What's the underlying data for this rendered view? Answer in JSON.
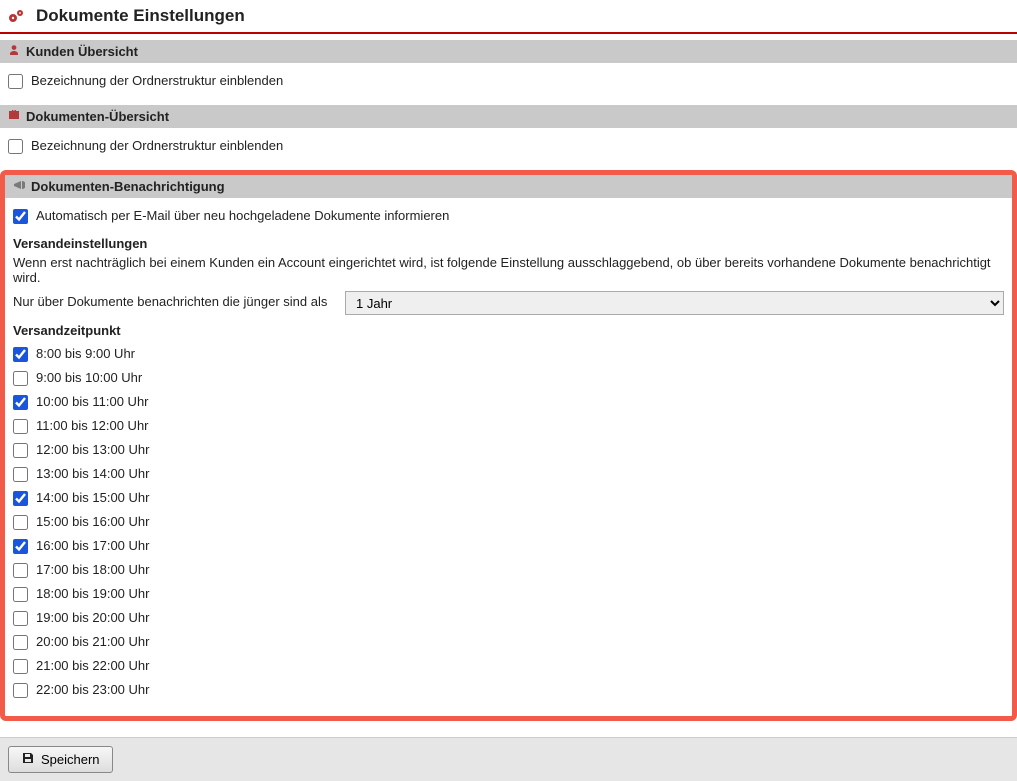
{
  "page": {
    "title": "Dokumente Einstellungen"
  },
  "sections": {
    "customers": {
      "title": "Kunden Übersicht",
      "cb_label": "Bezeichnung der Ordnerstruktur einblenden",
      "cb_checked": false
    },
    "documents": {
      "title": "Dokumenten-Übersicht",
      "cb_label": "Bezeichnung der Ordnerstruktur einblenden",
      "cb_checked": false
    },
    "notify": {
      "title": "Dokumenten-Benachrichtigung",
      "auto_label": "Automatisch per E-Mail über neu hochgeladene Dokumente informieren",
      "auto_checked": true,
      "dispatch_heading": "Versandeinstellungen",
      "dispatch_desc": "Wenn erst nachträglich bei einem Kunden ein Account eingerichtet wird, ist folgende Einstellung ausschlaggebend, ob über bereits vorhandene Dokumente benachrichtigt wird.",
      "age_label": "Nur über Dokumente benachrichten die jünger sind als",
      "age_value": "1 Jahr",
      "time_heading": "Versandzeitpunkt",
      "times": [
        {
          "label": "8:00 bis 9:00 Uhr",
          "checked": true
        },
        {
          "label": "9:00 bis 10:00 Uhr",
          "checked": false
        },
        {
          "label": "10:00 bis 11:00 Uhr",
          "checked": true
        },
        {
          "label": "11:00 bis 12:00 Uhr",
          "checked": false
        },
        {
          "label": "12:00 bis 13:00 Uhr",
          "checked": false
        },
        {
          "label": "13:00 bis 14:00 Uhr",
          "checked": false
        },
        {
          "label": "14:00 bis 15:00 Uhr",
          "checked": true
        },
        {
          "label": "15:00 bis 16:00 Uhr",
          "checked": false
        },
        {
          "label": "16:00 bis 17:00 Uhr",
          "checked": true
        },
        {
          "label": "17:00 bis 18:00 Uhr",
          "checked": false
        },
        {
          "label": "18:00 bis 19:00 Uhr",
          "checked": false
        },
        {
          "label": "19:00 bis 20:00 Uhr",
          "checked": false
        },
        {
          "label": "20:00 bis 21:00 Uhr",
          "checked": false
        },
        {
          "label": "21:00 bis 22:00 Uhr",
          "checked": false
        },
        {
          "label": "22:00 bis 23:00 Uhr",
          "checked": false
        }
      ]
    }
  },
  "footer": {
    "save_label": "Speichern"
  }
}
